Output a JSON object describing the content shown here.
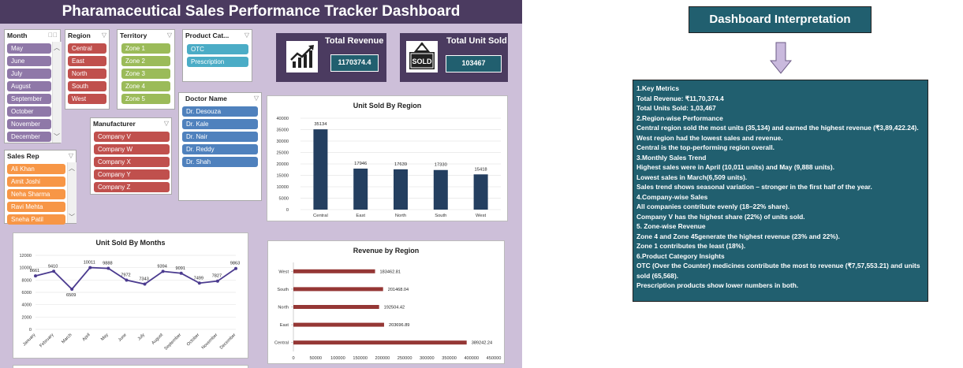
{
  "title": "Pharamaceutical Sales Performance Tracker Dashboard",
  "slicers": {
    "month": {
      "header": "Month",
      "items": [
        "May",
        "June",
        "July",
        "August",
        "September",
        "October",
        "November",
        "December"
      ]
    },
    "region": {
      "header": "Region",
      "items": [
        "Central",
        "East",
        "North",
        "South",
        "West"
      ]
    },
    "territory": {
      "header": "Territory",
      "items": [
        "Zone 1",
        "Zone 2",
        "Zone 3",
        "Zone 4",
        "Zone 5"
      ]
    },
    "product": {
      "header": "Product Cat...",
      "items": [
        "OTC",
        "Prescription"
      ]
    },
    "doctor": {
      "header": "Doctor Name",
      "items": [
        "Dr. Desouza",
        "Dr. Kale",
        "Dr. Nair",
        "Dr. Reddy",
        "Dr. Shah"
      ]
    },
    "manufacturer": {
      "header": "Manufacturer",
      "items": [
        "Company V",
        "Company W",
        "Company X",
        "Company Y",
        "Company Z"
      ]
    },
    "sales_rep": {
      "header": "Sales Rep",
      "items": [
        "Ali Khan",
        "Amit Joshi",
        "Neha Sharma",
        "Ravi Mehta",
        "Sneha Patil"
      ]
    }
  },
  "kpis": {
    "revenue": {
      "title": "Total Revenue",
      "value": "1170374.4",
      "icon": "chart-growth-icon"
    },
    "units": {
      "title": "Total Unit Sold",
      "value": "103467",
      "icon": "sold-sign-icon",
      "icon_text": "SOLD"
    }
  },
  "chart_data": [
    {
      "id": "units_by_region",
      "type": "bar",
      "title": "Unit Sold By Region",
      "categories": [
        "Central",
        "East",
        "North",
        "South",
        "West"
      ],
      "values": [
        35134,
        17946,
        17639,
        17330,
        15418
      ],
      "ylim": [
        0,
        40000
      ],
      "yticks": [
        0,
        5000,
        10000,
        15000,
        20000,
        25000,
        30000,
        35000,
        40000
      ],
      "color": "#243f60"
    },
    {
      "id": "units_by_month",
      "type": "line",
      "title": "Unit Sold By Months",
      "categories": [
        "January",
        "February",
        "March",
        "April",
        "May",
        "June",
        "July",
        "August",
        "September",
        "October",
        "November",
        "December"
      ],
      "values": [
        8661,
        9410,
        6509,
        10011,
        9888,
        7972,
        7343,
        9394,
        9091,
        7499,
        7827,
        9863
      ],
      "ylim": [
        0,
        12000
      ],
      "yticks": [
        0,
        2000,
        4000,
        6000,
        8000,
        10000,
        12000
      ],
      "color": "#4b3b8f"
    },
    {
      "id": "revenue_by_region",
      "type": "bar",
      "orientation": "horizontal",
      "title": "Revenue by Region",
      "categories": [
        "West",
        "South",
        "North",
        "East",
        "Central"
      ],
      "values": [
        183462.81,
        201468.04,
        192504.42,
        203696.89,
        389242.24
      ],
      "labels": [
        "183462.81",
        "201468.04",
        "192504.42",
        "203696.89",
        "389242.24"
      ],
      "xlim": [
        0,
        450000
      ],
      "xticks": [
        0,
        50000,
        100000,
        150000,
        200000,
        250000,
        300000,
        350000,
        400000,
        450000
      ],
      "color": "#953735"
    }
  ],
  "interpretation": {
    "heading": "Dashboard Interpretation",
    "lines": [
      "1.Key Metrics",
      "Total Revenue: ₹11,70,374.4",
      "Total Units Sold: 1,03,467",
      "2.Region-wise Performance",
      "Central region sold the most units (35,134) and earned the highest revenue (₹3,89,422.24).",
      "West region had the lowest sales and revenue.",
      "Central is the top-performing region overall.",
      "3.Monthly Sales Trend",
      "Highest sales were in April (10,011 units) and May (9,888 units).",
      "Lowest sales in March(6,509 units).",
      "Sales trend shows seasonal variation – stronger in the first half of the year.",
      "4.Company-wise Sales",
      "All companies contribute evenly (18–22% share).",
      "Company V has the highest share (22%) of units sold.",
      "5. Zone-wise Revenue",
      "Zone 4 and Zone 45generate the highest revenue (23% and 22%).",
      "Zone 1 contributes the least (18%).",
      "6.Product Category Insights",
      "OTC (Over the Counter) medicines contribute the most to revenue (₹7,57,553.21) and units",
      "sold (65,568).",
      "Prescription products show lower numbers in both."
    ]
  },
  "colors": {
    "dashboard_bg": "#cdbfd9",
    "title_bar": "#4b3b60",
    "teal": "#215f6f"
  }
}
